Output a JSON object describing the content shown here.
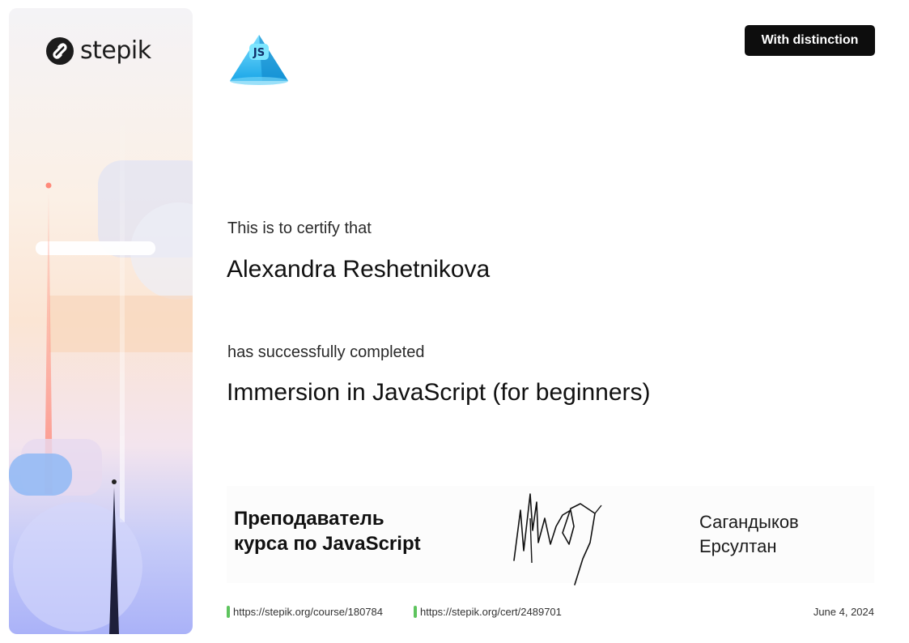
{
  "brand": {
    "name": "stepik"
  },
  "badge": {
    "label": "With distinction"
  },
  "course_logo": {
    "text": "JS"
  },
  "certificate": {
    "certify_text": "This is to certify that",
    "recipient": "Alexandra Reshetnikova",
    "completed_text": "has successfully completed",
    "course_title": "Immersion in JavaScript (for beginners)"
  },
  "instructor": {
    "role_line1": "Преподаватель",
    "role_line2": "курса по JavaScript",
    "name_line1": "Сагандыков",
    "name_line2": "Ерсултан"
  },
  "footer": {
    "course_url": "https://stepik.org/course/180784",
    "cert_url": "https://stepik.org/cert/2489701",
    "date": "June 4, 2024"
  },
  "colors": {
    "accent_green": "#5ec45e",
    "badge_bg": "#0d0d0d"
  }
}
